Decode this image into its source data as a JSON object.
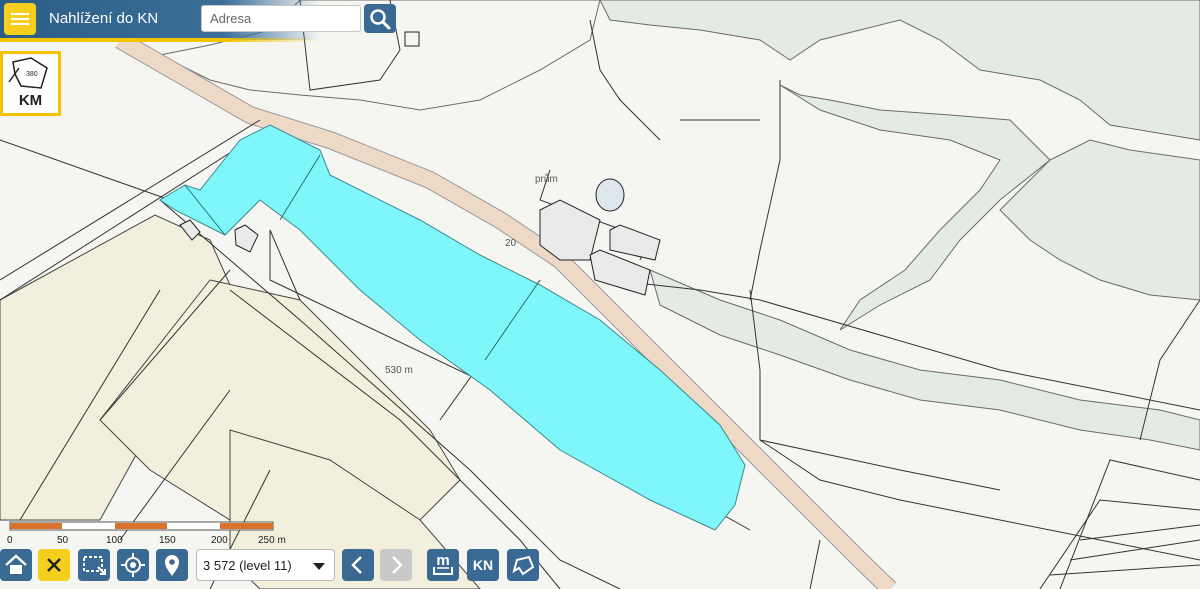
{
  "header": {
    "app_title": "Nahlížení do KN",
    "search_placeholder": "Adresa"
  },
  "layer_badge": {
    "label": "KM",
    "parcel_number": "380"
  },
  "map": {
    "labels": {
      "building_label": "prům",
      "elevation_label": "20",
      "road_label": "530 m"
    },
    "highlight_color": "#7ff6fa",
    "forest_color": "#e3ebe3"
  },
  "scale_bar": {
    "labels": [
      "0",
      "50",
      "100",
      "150",
      "200",
      "250 m"
    ],
    "colors": [
      "#d9722a",
      "#ffffff"
    ]
  },
  "toolbar": {
    "zoom_level_value": "3 572 (level 11)",
    "measure_label": "m",
    "kn_label": "KN",
    "icons": [
      "home-icon",
      "close-icon",
      "select-area-icon",
      "locate-icon",
      "marker-icon",
      "chevron-down-icon",
      "chevron-left-icon",
      "chevron-right-icon",
      "measure-icon",
      "polygon-icon"
    ]
  }
}
